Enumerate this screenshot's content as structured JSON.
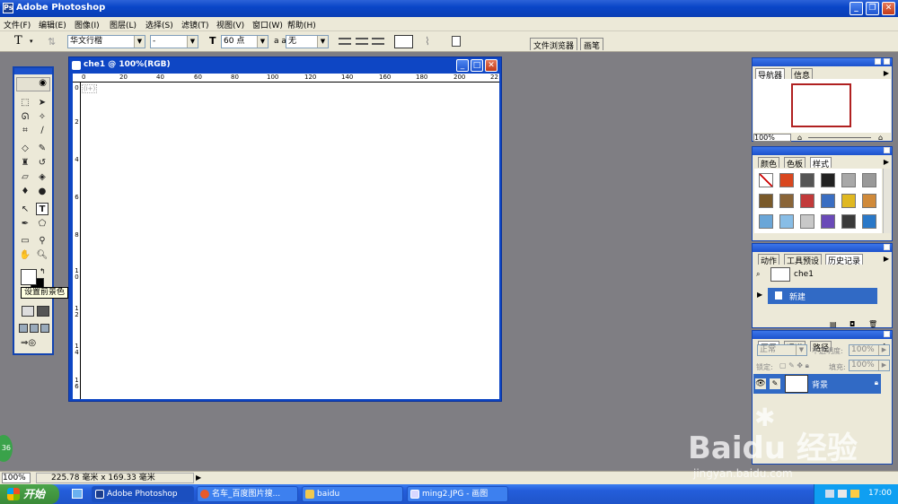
{
  "window": {
    "title": "Adobe Photoshop"
  },
  "menu": [
    "文件(F)",
    "编辑(E)",
    "图像(I)",
    "图层(L)",
    "选择(S)",
    "滤镜(T)",
    "视图(V)",
    "窗口(W)",
    "帮助(H)"
  ],
  "options": {
    "tool_glyph": "T",
    "font_family": "华文行楷",
    "font_style": "-",
    "font_size": "60 点",
    "aa_label": "a a",
    "antialias": "无",
    "tab_filebrowser": "文件浏览器",
    "tab_brushes": "画笔"
  },
  "document": {
    "title": "che1 @ 100%(RGB)",
    "ruler_h": [
      "0",
      "20",
      "40",
      "60",
      "80",
      "100",
      "120",
      "140",
      "160",
      "180",
      "200",
      "22"
    ],
    "ruler_v": [
      "0",
      "2",
      "4",
      "6",
      "8",
      "1",
      "1",
      "1",
      "1",
      "1",
      "2"
    ],
    "ruler_v2": [
      "",
      "",
      "",
      "",
      "",
      "0",
      "2",
      "4",
      "6",
      "8",
      "0"
    ],
    "corner_text": "(i+)"
  },
  "toolbox": {
    "tooltip": "设置前景色"
  },
  "navigator": {
    "tabs": [
      "导航器",
      "信息"
    ],
    "zoom": "100%"
  },
  "swatches": {
    "tabs": [
      "颜色",
      "色板",
      "样式"
    ],
    "colors": [
      "#ffffff",
      "#d9471f",
      "#555555",
      "#222222",
      "#a8a8a8",
      "#999999",
      "#7a5a2a",
      "#8a6538",
      "#c23a3a",
      "#3a6ec2",
      "#e0b820",
      "#d08a3a",
      "#6aa6d8",
      "#88bde6",
      "#c8c8c8",
      "#6a4ab8",
      "#3a3a3a",
      "#2a78c8"
    ]
  },
  "history": {
    "tabs": [
      "动作",
      "工具预设",
      "历史记录"
    ],
    "snapshot": "che1",
    "step": "新建"
  },
  "layers": {
    "tabs": [
      "图层",
      "通道",
      "路径"
    ],
    "blend_mode": "正常",
    "opacity_label": "不透明度:",
    "opacity": "100%",
    "lock_label": "锁定:",
    "fill_label": "填充:",
    "fill": "100%",
    "layer_name": "背景"
  },
  "status": {
    "zoom": "100%",
    "doc_size": "225.78 毫米 x 169.33 毫米",
    "badge": "36"
  },
  "taskbar": {
    "start": "开始",
    "tasks": [
      "Adobe Photoshop",
      "名车_百度图片搜...",
      "baidu",
      "ming2.JPG - 画图"
    ],
    "clock": "17:00"
  },
  "watermark": {
    "brand": "Baidu 经验",
    "url": "jingyan.baidu.com"
  },
  "colors": {
    "xp_blue": "#0a46c8",
    "panel_bg": "#ece9d8",
    "workspace": "#7f7e83"
  }
}
